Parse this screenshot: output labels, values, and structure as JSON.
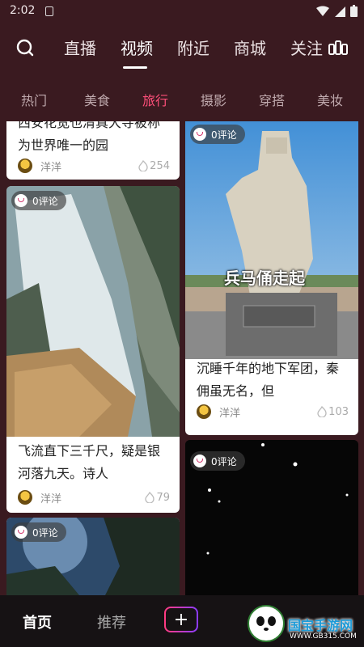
{
  "status_bar": {
    "time": "2:02"
  },
  "top_nav": {
    "tabs": [
      "直播",
      "视频",
      "附近",
      "商城",
      "关注"
    ],
    "active_tab": "视频"
  },
  "sub_nav": {
    "items": [
      "热门",
      "美食",
      "旅行",
      "摄影",
      "穿搭",
      "美妆"
    ],
    "active": "旅行"
  },
  "feed": {
    "cards": [
      {
        "title": "西安花宽也清真大寺被称为世界唯一的园",
        "author": "洋洋",
        "likes": "254",
        "comments": ""
      },
      {
        "title": "飞流直下三千尺，疑是银河落九天。诗人",
        "author": "洋洋",
        "likes": "79",
        "comments": "0评论"
      },
      {
        "title": "",
        "author": "",
        "likes": "",
        "comments": "0评论"
      },
      {
        "title": "沉睡千年的地下军团，秦佣虽无名，但",
        "author": "洋洋",
        "likes": "103",
        "comments": "0评论",
        "overlay_text": "兵马俑走起"
      },
      {
        "title": "",
        "author": "",
        "likes": "",
        "comments": "0评论"
      }
    ]
  },
  "bottom_nav": {
    "home": "首页",
    "recommend": "推荐",
    "add": "+"
  },
  "watermark": {
    "text": "国宝手游网",
    "url": "WWW.GB315.COM"
  },
  "colors": {
    "background": "#3a1a20",
    "accent": "#ff4f7a",
    "bottom_bar": "#161214"
  }
}
